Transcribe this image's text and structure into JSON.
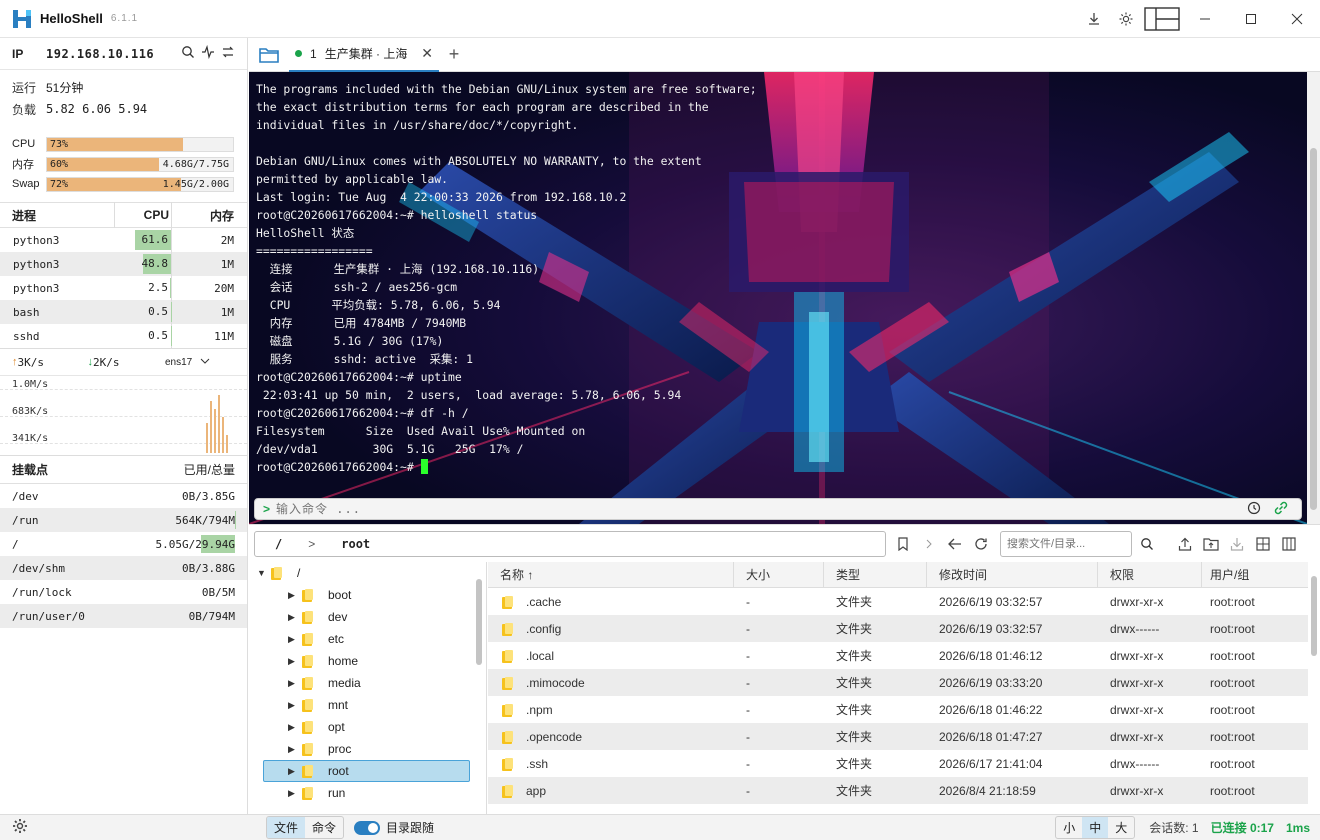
{
  "app": {
    "name": "HelloShell",
    "version": "6.1.1"
  },
  "sidebar": {
    "ip_label": "IP",
    "ip_value": "192.168.10.116",
    "uptime_label": "运行",
    "uptime_value": "51分钟",
    "load_label": "负载",
    "load_value": "5.82 6.06 5.94",
    "cpu": {
      "label": "CPU",
      "percent": "73%",
      "fraction": 0.73
    },
    "mem": {
      "label": "内存",
      "percent": "60%",
      "fraction": 0.6,
      "amount": "4.68G/7.75G"
    },
    "swap": {
      "label": "Swap",
      "percent": "72%",
      "fraction": 0.72,
      "amount": "1.45G/2.00G"
    },
    "proc_headers": {
      "name": "进程",
      "cpu": "CPU",
      "mem": "内存"
    },
    "processes": [
      {
        "name": "python3",
        "cpu": "61.6",
        "cpu_val": 61.6,
        "mem": "2M"
      },
      {
        "name": "python3",
        "cpu": "48.8",
        "cpu_val": 48.8,
        "mem": "1M"
      },
      {
        "name": "python3",
        "cpu": "2.5",
        "cpu_val": 2.5,
        "mem": "20M"
      },
      {
        "name": "bash",
        "cpu": "0.5",
        "cpu_val": 0.5,
        "mem": "1M"
      },
      {
        "name": "sshd",
        "cpu": "0.5",
        "cpu_val": 0.5,
        "mem": "11M"
      }
    ],
    "net": {
      "up": "3K/s",
      "down": "2K/s",
      "iface": "ens17",
      "scale": [
        "1.0M/s",
        "683K/s",
        "341K/s"
      ]
    },
    "mount_headers": {
      "point": "挂载点",
      "usage": "已用/总量"
    },
    "mounts": [
      {
        "point": "/dev",
        "usage": "0B/3.85G",
        "fraction": 0
      },
      {
        "point": "/run",
        "usage": "564K/794M",
        "fraction": 0.001
      },
      {
        "point": "/",
        "usage": "5.05G/29.94G",
        "fraction": 0.17
      },
      {
        "point": "/dev/shm",
        "usage": "0B/3.88G",
        "fraction": 0
      },
      {
        "point": "/run/lock",
        "usage": "0B/5M",
        "fraction": 0
      },
      {
        "point": "/run/user/0",
        "usage": "0B/794M",
        "fraction": 0
      }
    ]
  },
  "tabs": [
    {
      "num": "1",
      "label": "生产集群 · 上海"
    }
  ],
  "terminal": {
    "lines": [
      "The programs included with the Debian GNU/Linux system are free software;",
      "the exact distribution terms for each program are described in the",
      "individual files in /usr/share/doc/*/copyright.",
      "",
      "Debian GNU/Linux comes with ABSOLUTELY NO WARRANTY, to the extent",
      "permitted by applicable law.",
      "Last login: Tue Aug  4 22:00:33 2026 from 192.168.10.2",
      "root@C20260617662004:~# helloshell status",
      "HelloShell 状态",
      "=================",
      "  连接      生产集群 · 上海 (192.168.10.116)",
      "  会话      ssh-2 / aes256-gcm",
      "  CPU      平均负载: 5.78, 6.06, 5.94",
      "  内存      已用 4784MB / 7940MB",
      "  磁盘      5.1G / 30G (17%)",
      "  服务      sshd: active  采集: 1",
      "root@C20260617662004:~# uptime",
      " 22:03:41 up 50 min,  2 users,  load average: 5.78, 6.06, 5.94",
      "root@C20260617662004:~# df -h /",
      "Filesystem      Size  Used Avail Use% Mounted on",
      "/dev/vda1        30G  5.1G   25G  17% /"
    ],
    "prompt": "root@C20260617662004:~# ",
    "cmd_placeholder": "输入命令 ..."
  },
  "path": {
    "root": "/",
    "sep": ">",
    "current": "root",
    "search_placeholder": "搜索文件/目录..."
  },
  "tree": {
    "root": "/",
    "items": [
      "boot",
      "dev",
      "etc",
      "home",
      "media",
      "mnt",
      "opt",
      "proc",
      "root",
      "run"
    ],
    "selected": "root"
  },
  "files": {
    "headers": {
      "name": "名称 ↑",
      "size": "大小",
      "type": "类型",
      "mtime": "修改时间",
      "perm": "权限",
      "owner": "用户/组"
    },
    "rows": [
      {
        "name": ".cache",
        "size": "-",
        "type": "文件夹",
        "mtime": "2026/6/19 03:32:57",
        "perm": "drwxr-xr-x",
        "owner": "root:root"
      },
      {
        "name": ".config",
        "size": "-",
        "type": "文件夹",
        "mtime": "2026/6/19 03:32:57",
        "perm": "drwx------",
        "owner": "root:root"
      },
      {
        "name": ".local",
        "size": "-",
        "type": "文件夹",
        "mtime": "2026/6/18 01:46:12",
        "perm": "drwxr-xr-x",
        "owner": "root:root"
      },
      {
        "name": ".mimocode",
        "size": "-",
        "type": "文件夹",
        "mtime": "2026/6/19 03:33:20",
        "perm": "drwxr-xr-x",
        "owner": "root:root"
      },
      {
        "name": ".npm",
        "size": "-",
        "type": "文件夹",
        "mtime": "2026/6/18 01:46:22",
        "perm": "drwxr-xr-x",
        "owner": "root:root"
      },
      {
        "name": ".opencode",
        "size": "-",
        "type": "文件夹",
        "mtime": "2026/6/18 01:47:27",
        "perm": "drwxr-xr-x",
        "owner": "root:root"
      },
      {
        "name": ".ssh",
        "size": "-",
        "type": "文件夹",
        "mtime": "2026/6/17 21:41:04",
        "perm": "drwx------",
        "owner": "root:root"
      },
      {
        "name": "app",
        "size": "-",
        "type": "文件夹",
        "mtime": "2026/8/4 21:18:59",
        "perm": "drwxr-xr-x",
        "owner": "root:root"
      }
    ]
  },
  "statusbar": {
    "tab_file": "文件",
    "tab_cmd": "命令",
    "follow_label": "目录跟随",
    "size_small": "小",
    "size_mid": "中",
    "size_large": "大",
    "sessions": "会话数: 1",
    "connected": "已连接 0:17",
    "latency": "1ms"
  },
  "colors": {
    "accent": "#2a7fc1",
    "cpu_bar": "#ebb57a",
    "proc_bar": "#a9d4a5",
    "connected": "#1aa34a",
    "cursor": "#2bff2b"
  }
}
